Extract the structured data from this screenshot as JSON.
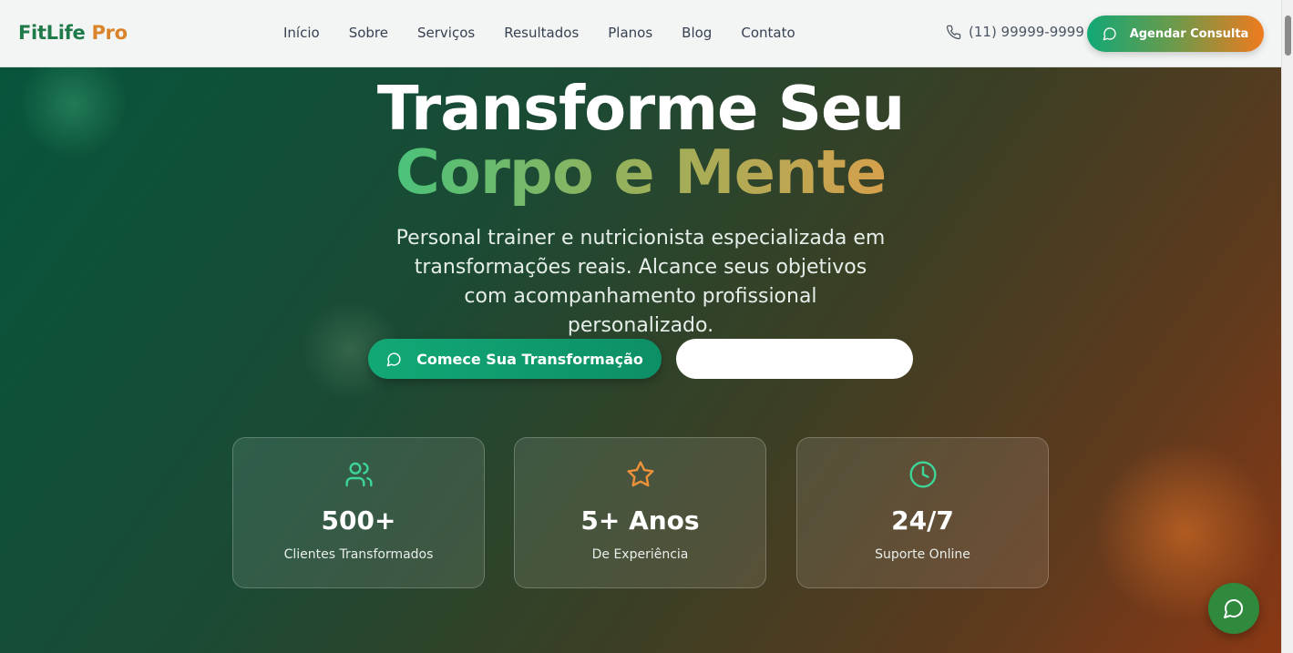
{
  "brand": {
    "name_part1": "FitLife",
    "name_part2": "Pro"
  },
  "nav": {
    "items": [
      {
        "label": "Início"
      },
      {
        "label": "Sobre"
      },
      {
        "label": "Serviços"
      },
      {
        "label": "Resultados"
      },
      {
        "label": "Planos"
      },
      {
        "label": "Blog"
      },
      {
        "label": "Contato"
      }
    ]
  },
  "header": {
    "phone": "(11) 99999-9999",
    "phone_icon": "phone-icon",
    "cta_label": "Agendar Consulta",
    "cta_icon": "chat-bubble-icon"
  },
  "hero": {
    "title_line1": "Transforme Seu",
    "title_line2": "Corpo e Mente",
    "subtitle": "Personal trainer e nutricionista especializada em transformações reais. Alcance seus objetivos com acompanhamento profissional personalizado.",
    "primary_button": "Comece Sua Transformação",
    "secondary_button": ""
  },
  "stats": [
    {
      "value": "500+",
      "label": "Clientes Transformados",
      "icon": "users-icon",
      "color": "#3ed598"
    },
    {
      "value": "5+ Anos",
      "label": "De Experiência",
      "icon": "star-icon",
      "color": "#f0923a"
    },
    {
      "value": "24/7",
      "label": "Suporte Online",
      "icon": "clock-icon",
      "color": "#3ed598"
    }
  ],
  "colors": {
    "primary": "#12a876",
    "accent": "#f07a1e",
    "fab": "#2f8a3e"
  }
}
